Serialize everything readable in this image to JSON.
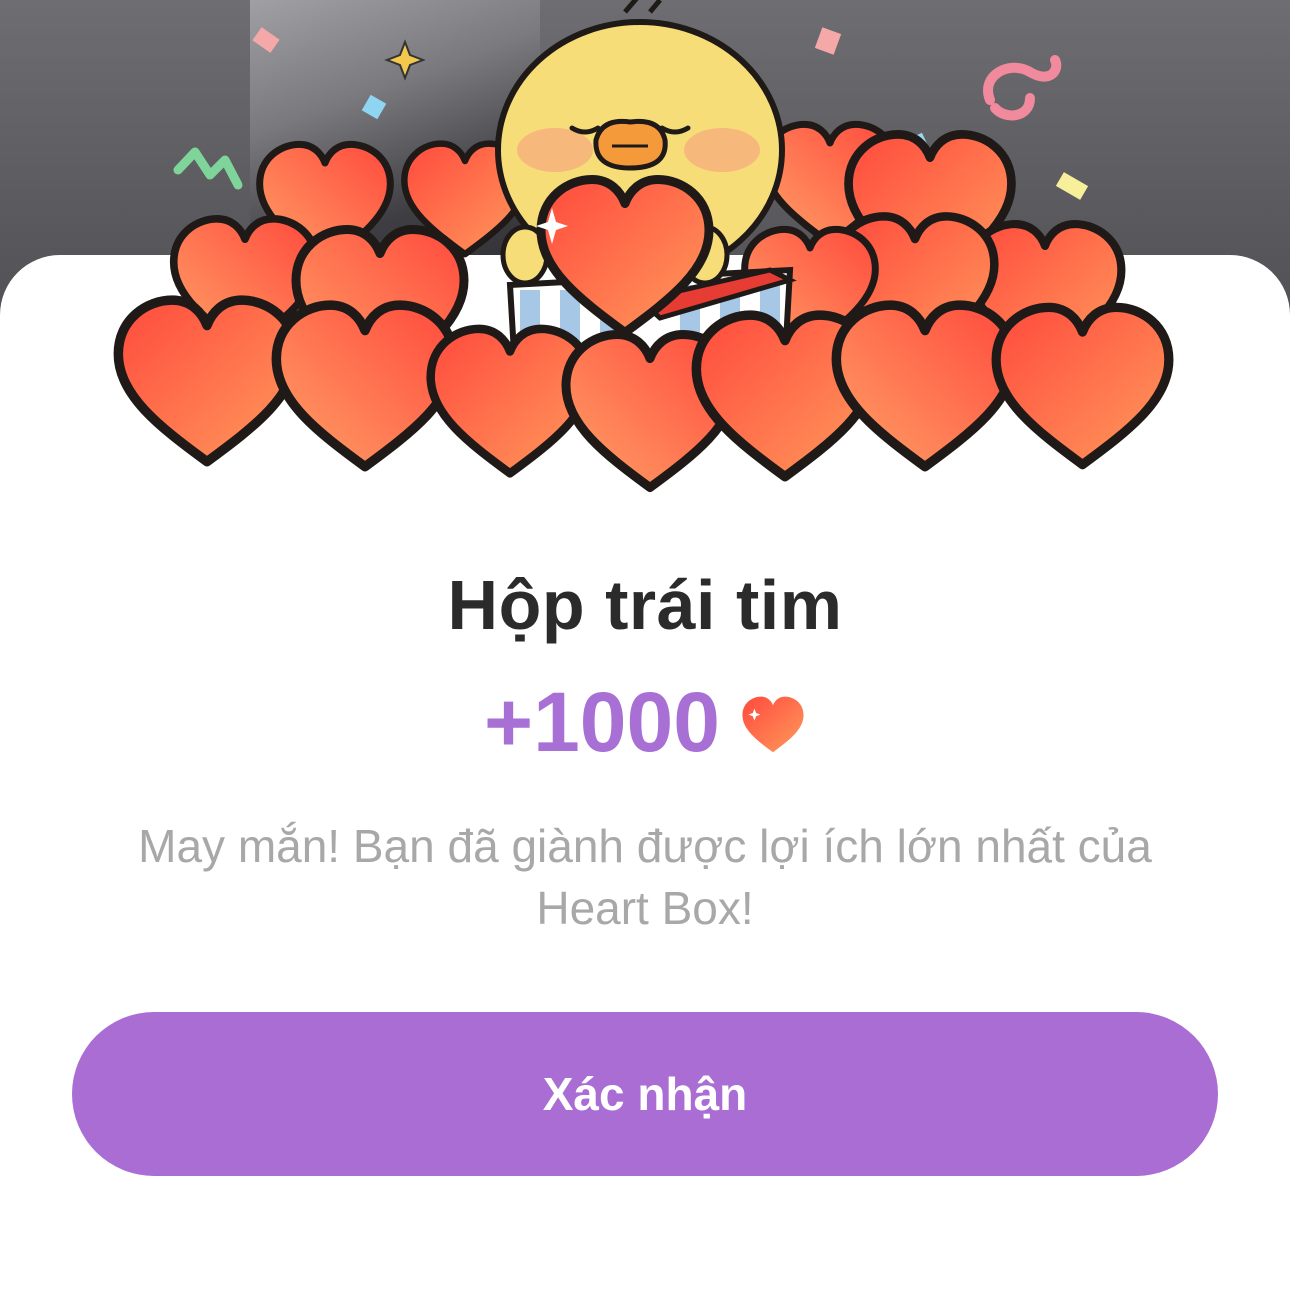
{
  "dialog": {
    "title": "Hộp trái tim",
    "reward_amount": "+1000",
    "reward_icon": "heart-icon",
    "message": "May mắn! Bạn đã giành được lợi ích lớn nhất của Heart Box!",
    "confirm_label": "Xác nhận"
  },
  "colors": {
    "accent": "#a96dd3",
    "reward_text": "#a86fd4",
    "title_text": "#2b2b2b",
    "message_text": "#a8a8a8",
    "heart_light": "#ff9a5c",
    "heart_dark": "#ff4a3d",
    "chick": "#f6dd78"
  }
}
